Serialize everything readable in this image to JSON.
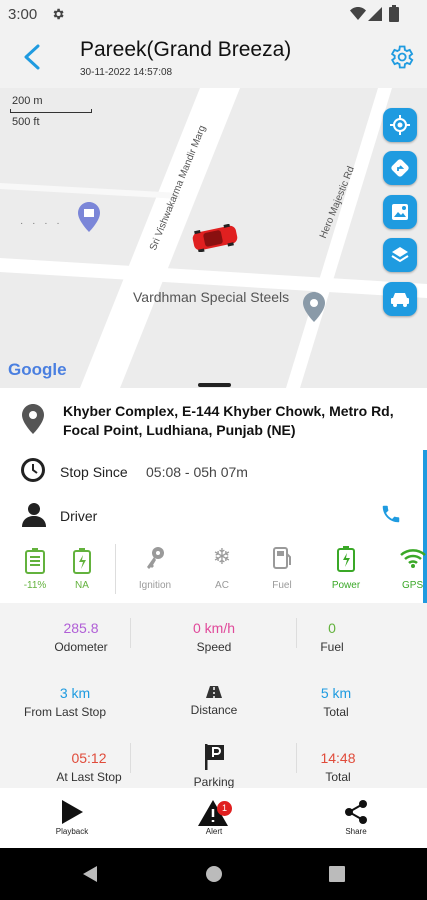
{
  "status_bar": {
    "time": "3:00"
  },
  "header": {
    "title": "Pareek(Grand Breeza)",
    "subtitle": "30-11-2022 14:57:08"
  },
  "map": {
    "scale_metric": "200 m",
    "scale_imperial": "500 ft",
    "road_1": "Sri Vishwakarma Mandir Marg",
    "road_2": "Hero Majestic Rd",
    "poi": "Vardhman Special Steels",
    "attribution": "Google",
    "buttons": [
      "locate-icon",
      "route-icon",
      "map-type-icon",
      "layers-icon",
      "vehicle-icon"
    ]
  },
  "location": {
    "address": "Khyber Complex, E-144 Khyber Chowk, Metro Rd, Focal Point, Ludhiana, Punjab (NE)"
  },
  "stop": {
    "label": "Stop Since",
    "value": "05:08 - 05h 07m"
  },
  "driver": {
    "label": "Driver"
  },
  "status_strip": {
    "battery_value": "-11%",
    "charge_value": "NA",
    "items": [
      {
        "label": "Ignition",
        "color": "#9a9a9a"
      },
      {
        "label": "AC",
        "color": "#9a9a9a"
      },
      {
        "label": "Fuel",
        "color": "#9a9a9a"
      },
      {
        "label": "Power",
        "color": "#3aa827"
      },
      {
        "label": "GPS",
        "color": "#3aa827"
      }
    ]
  },
  "stats": {
    "odometer": {
      "value": "285.8",
      "label": "Odometer",
      "color": "#b05ed6"
    },
    "speed": {
      "value": "0 km/h",
      "label": "Speed",
      "color": "#e0499a"
    },
    "fuel": {
      "value": "0",
      "label": "Fuel",
      "color": "#63b23d"
    },
    "from_last_stop": {
      "value": "3 km",
      "label": "From Last Stop",
      "color": "#1f9be0"
    },
    "distance": {
      "label": "Distance"
    },
    "total_km": {
      "value": "5 km",
      "label": "Total",
      "color": "#1f9be0"
    },
    "at_last_stop": {
      "value": "05:12",
      "label": "At Last Stop",
      "color": "#e04b3a"
    },
    "parking": {
      "label": "Parking"
    },
    "total_time": {
      "value": "14:48",
      "label": "Total",
      "color": "#e04b3a"
    }
  },
  "bottom_nav": {
    "playback": "Playback",
    "alert": "Alert",
    "alert_badge": "1",
    "share": "Share"
  },
  "colors": {
    "accent": "#1f9be0",
    "car": "#e02020"
  }
}
